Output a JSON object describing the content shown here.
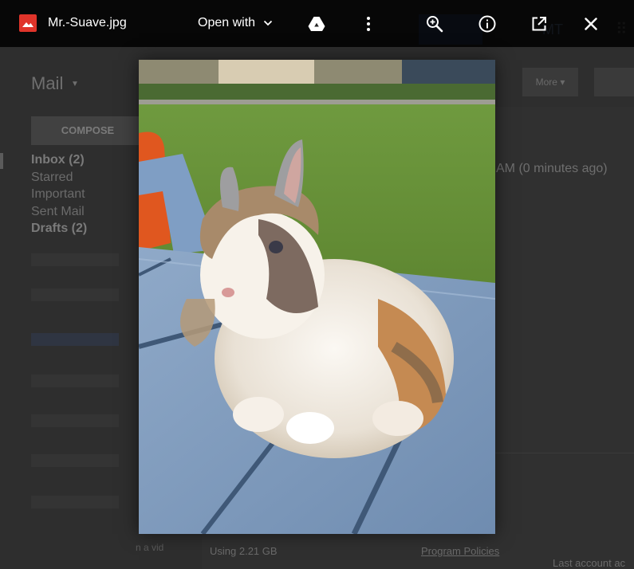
{
  "viewer": {
    "filename": "Mr.-Suave.jpg",
    "open_with_label": "Open with",
    "icons": {
      "file_type": "image-file-icon",
      "drive": "drive-icon",
      "more": "more-vert-icon",
      "zoom": "zoom-in-icon",
      "info": "info-icon",
      "open_new": "open-in-new-window-icon",
      "close": "close-icon"
    },
    "image_description_alt": "Fluffy lionhead rabbit with a swept hairstyle sitting on a blue picnic table"
  },
  "background_gmail": {
    "mail_label": "Mail",
    "compose_label": "COMPOSE",
    "nav": [
      {
        "label": "Inbox (2)",
        "bold": true
      },
      {
        "label": "Starred",
        "bold": false
      },
      {
        "label": "Important",
        "bold": false
      },
      {
        "label": "Sent Mail",
        "bold": false
      },
      {
        "label": "Drafts (2)",
        "bold": true
      }
    ],
    "more_label": "More",
    "timestamp_fragment": "AM (0 minutes ago)",
    "storage_usage": "Using 2.21 GB",
    "program_policies": "Program Policies",
    "last_account_activity": "Last account ac",
    "footnote_fragment": "n a vid"
  },
  "colors": {
    "toolbar_bg": "#000000",
    "file_icon_red": "#e0342a",
    "icon_white": "#ffffff"
  }
}
